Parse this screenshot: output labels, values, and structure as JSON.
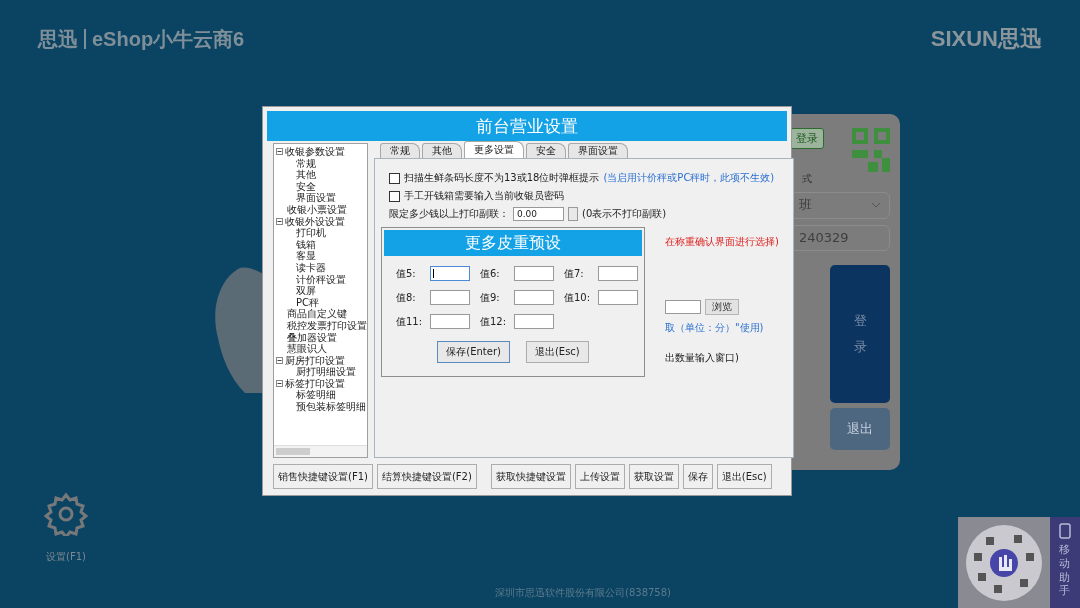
{
  "header": {
    "brand": "思迅",
    "product": "eShop小牛云商6",
    "vendor_logo": "SIXUN思迅"
  },
  "login_panel": {
    "tag": "登录",
    "mode_label": "式",
    "shift_value": "班",
    "code_value": "240329",
    "login_button": "登录",
    "exit_button": "退出"
  },
  "settings_shortcut": {
    "label": "设置(F1)"
  },
  "footer": "深圳市思迅软件股份有限公司(838758)",
  "mobile_assistant": {
    "label": "移动助手"
  },
  "dialog": {
    "title": "前台营业设置",
    "tree": [
      {
        "label": "收银参数设置",
        "expanded": true,
        "children": [
          {
            "label": "常规"
          },
          {
            "label": "其他"
          },
          {
            "label": "安全"
          },
          {
            "label": "界面设置"
          }
        ]
      },
      {
        "label": "收银小票设置"
      },
      {
        "label": "收银外设设置",
        "expanded": true,
        "children": [
          {
            "label": "打印机"
          },
          {
            "label": "钱箱"
          },
          {
            "label": "客显"
          },
          {
            "label": "读卡器"
          },
          {
            "label": "计价秤设置"
          },
          {
            "label": "双屏"
          },
          {
            "label": "PC秤"
          }
        ]
      },
      {
        "label": "商品自定义键"
      },
      {
        "label": "税控发票打印设置"
      },
      {
        "label": "叠加器设置"
      },
      {
        "label": "慧眼识人"
      },
      {
        "label": "厨房打印设置",
        "expanded": true,
        "children": [
          {
            "label": "厨打明细设置"
          }
        ]
      },
      {
        "label": "标签打印设置",
        "expanded": true,
        "children": [
          {
            "label": "标签明细"
          },
          {
            "label": "预包装标签明细"
          }
        ]
      }
    ],
    "tabs": [
      {
        "label": "常规",
        "selected": false
      },
      {
        "label": "其他",
        "selected": false
      },
      {
        "label": "更多设置",
        "selected": true
      },
      {
        "label": "安全",
        "selected": false
      },
      {
        "label": "界面设置",
        "selected": false
      }
    ],
    "options": [
      {
        "kind": "checkbox",
        "label": "扫描生鲜条码长度不为13或18位时弹框提示",
        "note": "(当启用计价秤或PC秤时，此项不生效)",
        "checked": false
      },
      {
        "kind": "checkbox",
        "label": "手工开钱箱需要输入当前收银员密码",
        "checked": false
      },
      {
        "kind": "number",
        "label": "限定多少钱以上打印副联：",
        "value": "0.00",
        "note": "(0表示不打印副联)"
      }
    ],
    "partly_hidden": {
      "weigh_note": "在称重确认界面进行选择)",
      "browse_button": "浏览",
      "unit_note": "取（单位：分）\"使用)",
      "qty_note": "出数量输入窗口)"
    },
    "buttons": [
      "销售快捷键设置(F1)",
      "结算快捷键设置(F2)",
      "获取快捷键设置",
      "上传设置",
      "获取设置",
      "保存",
      "退出(Esc)"
    ]
  },
  "popup": {
    "title": "更多皮重预设",
    "fields": [
      {
        "label": "值5:",
        "focused": true
      },
      {
        "label": "值6:",
        "focused": false
      },
      {
        "label": "值7:",
        "focused": false
      },
      {
        "label": "值8:",
        "focused": false
      },
      {
        "label": "值9:",
        "focused": false
      },
      {
        "label": "值10:",
        "focused": false
      },
      {
        "label": "值11:",
        "focused": false
      },
      {
        "label": "值12:",
        "focused": false
      }
    ],
    "buttons": [
      "保存(Enter)",
      "退出(Esc)"
    ]
  }
}
